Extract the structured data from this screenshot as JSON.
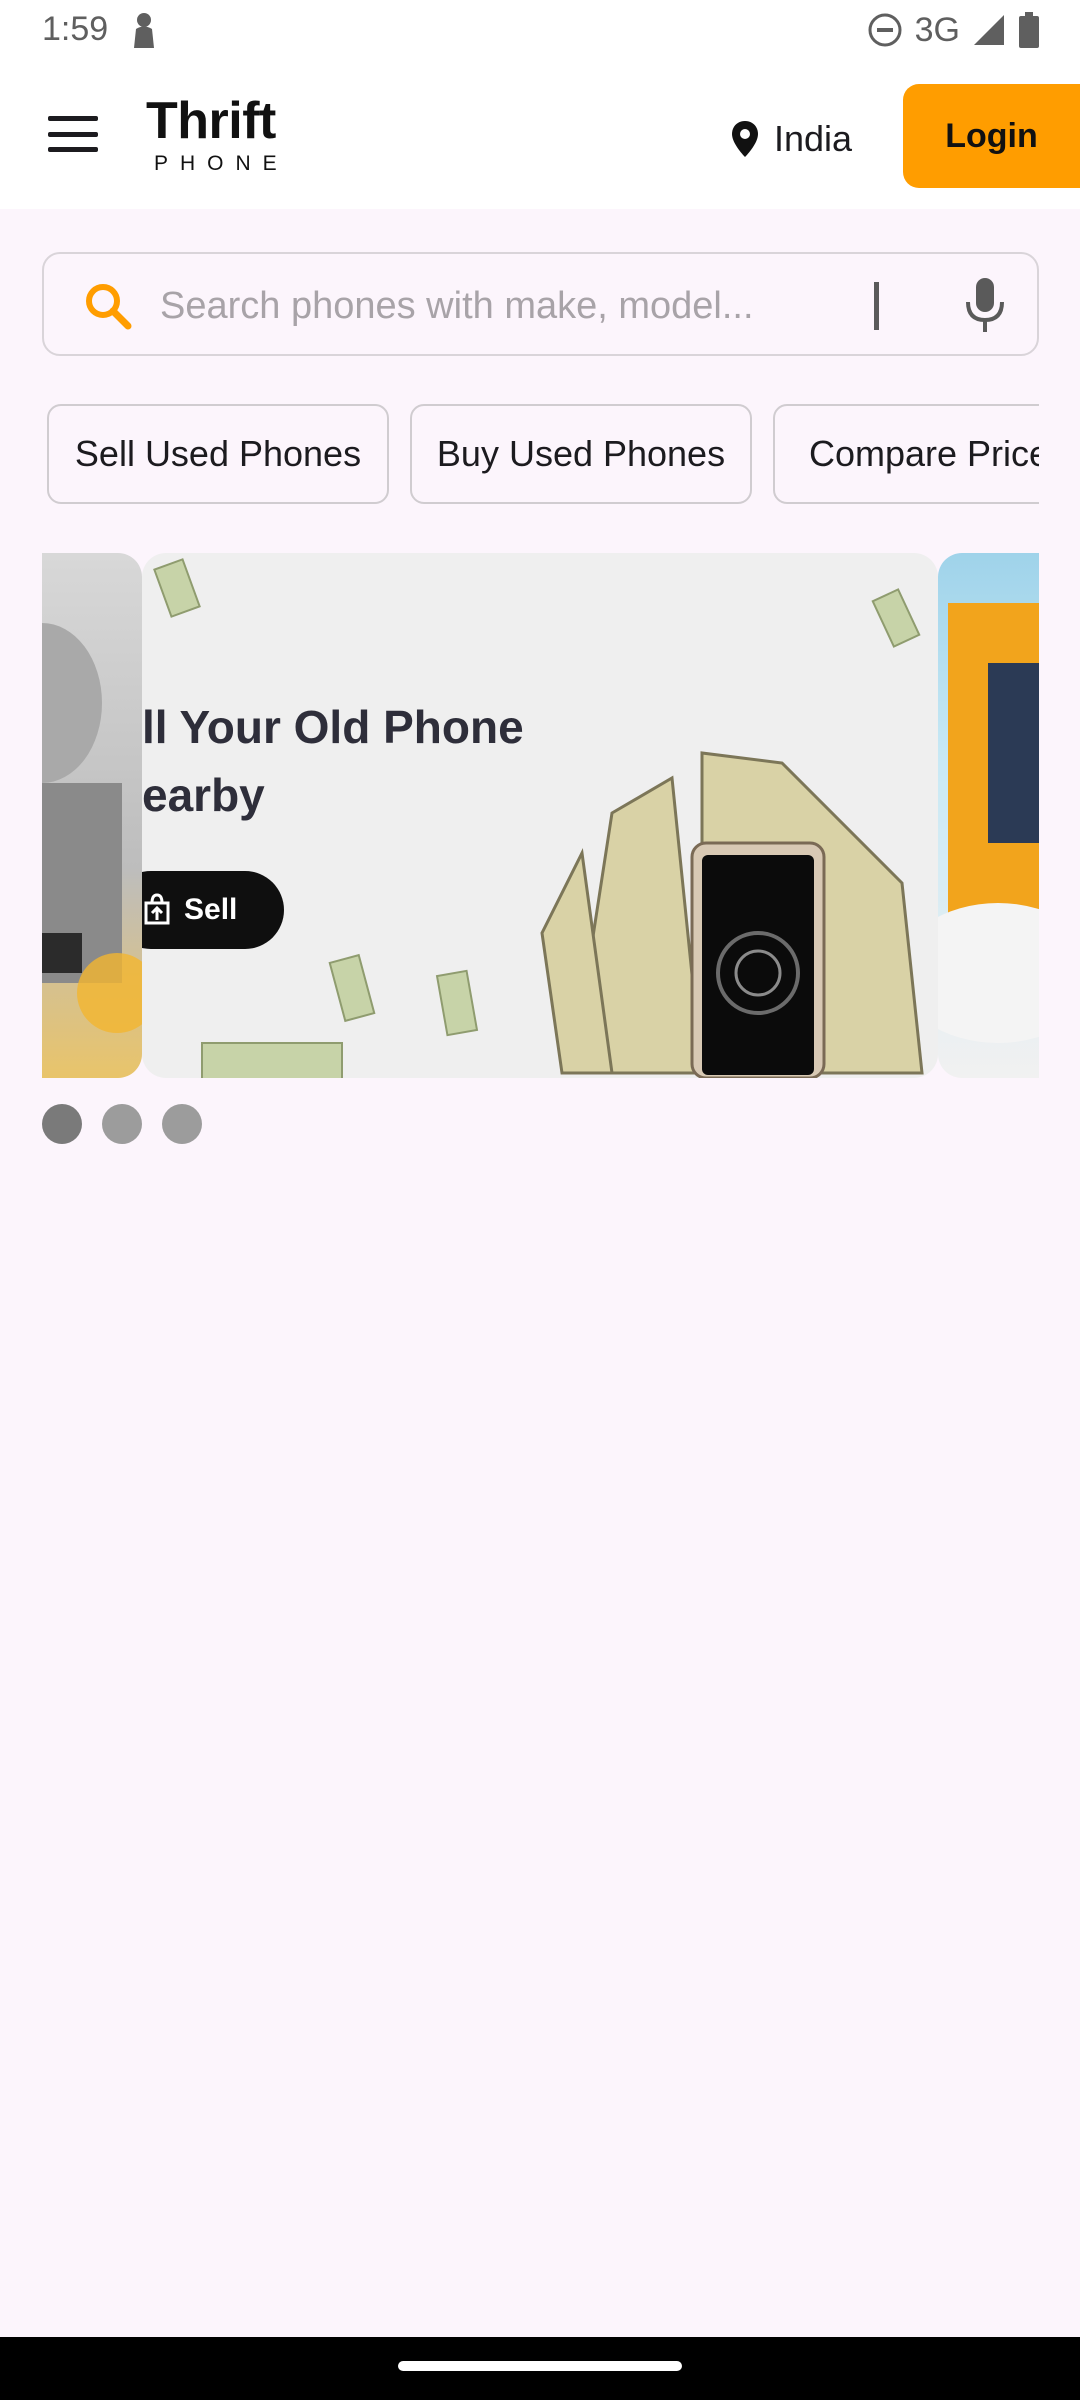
{
  "status_bar": {
    "time": "1:59",
    "network": "3G",
    "icons": [
      "person-silhouette-icon",
      "do-not-disturb-icon",
      "signal-icon",
      "battery-icon"
    ]
  },
  "app_bar": {
    "menu_icon": "hamburger-menu-icon",
    "logo_title": "Thrift",
    "logo_subtitle": "PHONE",
    "location_icon": "location-pin-icon",
    "location": "India",
    "login_label": "Login",
    "login_color": "#ff9d00"
  },
  "search": {
    "placeholder": "Search phones with make, model...",
    "value": "",
    "search_icon": "search-icon",
    "mic_icon": "microphone-icon",
    "accent": "#ff9d00"
  },
  "chips": [
    {
      "label": "Sell Used Phones"
    },
    {
      "label": "Buy Used Phones"
    },
    {
      "label": "Compare Prices"
    }
  ],
  "carousel": {
    "main_slide": {
      "title_line1": "ll Your Old Phone",
      "title_line2": "earby",
      "button_label": "Sell",
      "button_icon": "sell-upload-icon"
    },
    "dots": 3
  },
  "nav_bar": {
    "handle": "gesture-handle"
  }
}
